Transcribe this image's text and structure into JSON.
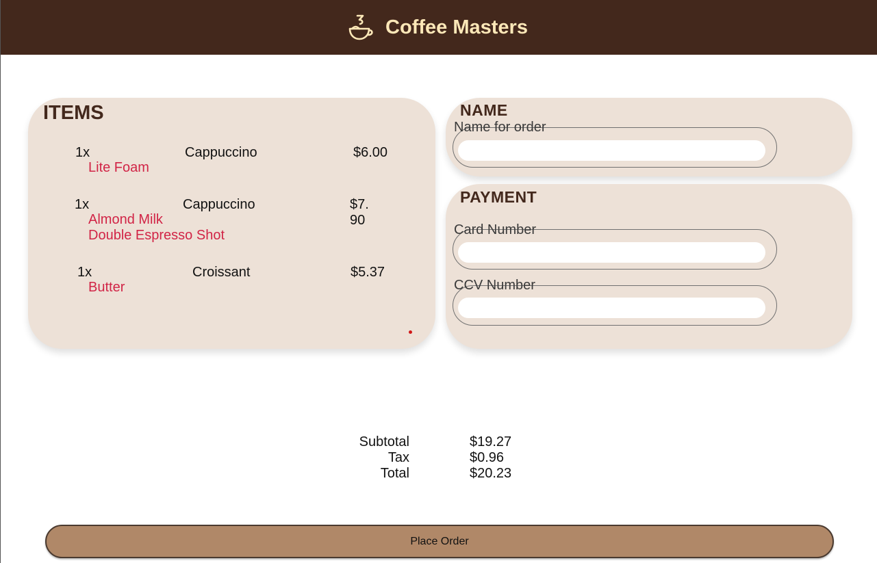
{
  "header": {
    "title": "Coffee Masters",
    "logo_icon": "coffee-cup-icon",
    "background": "#43281c",
    "title_color": "#fde8b8"
  },
  "items": {
    "heading": "ITEMS",
    "list": [
      {
        "qty": "1x",
        "name": "Cappuccino",
        "price": "$6.00",
        "options": [
          "Lite Foam"
        ]
      },
      {
        "qty": "1x",
        "name": "Cappuccino",
        "price": "$7. 90",
        "options": [
          "Almond Milk",
          "Double Espresso Shot"
        ]
      },
      {
        "qty": "1x",
        "name": "Croissant",
        "price": "$5.37",
        "options": [
          "Butter"
        ]
      }
    ]
  },
  "name_section": {
    "heading": "NAME",
    "label": "Name for order",
    "value": ""
  },
  "payment_section": {
    "heading": "PAYMENT",
    "card_label": "Card Number",
    "card_value": "",
    "ccv_label": "CCV Number",
    "ccv_value": ""
  },
  "totals": {
    "subtotal_label": "Subtotal",
    "subtotal_value": "$19.27",
    "tax_label": "Tax",
    "tax_value": "$0.96",
    "total_label": "Total",
    "total_value": "$20.23"
  },
  "actions": {
    "place_order_label": "Place Order"
  },
  "colors": {
    "card_background": "#ede1d7",
    "option_text": "#d12446",
    "button_background": "#b08868"
  }
}
